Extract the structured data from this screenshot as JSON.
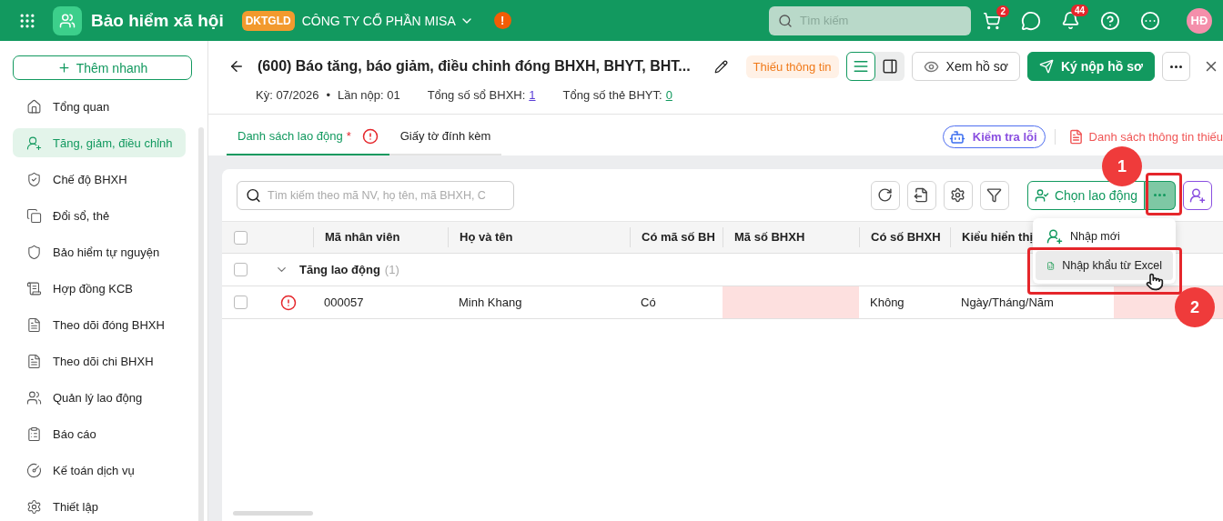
{
  "header": {
    "app_title": "Bảo hiểm xã hội",
    "company_badge": "DKTGLD",
    "company": "CÔNG TY CỔ PHẦN MISA",
    "alert": "!",
    "search_placeholder": "Tìm kiếm",
    "cart_badge": "2",
    "notification_badge": "44",
    "avatar": "HĐ"
  },
  "sidebar": {
    "quick_add": "Thêm nhanh",
    "items": [
      {
        "label": "Tổng quan",
        "selected": false
      },
      {
        "label": "Tăng, giảm, điều chỉnh",
        "selected": true
      },
      {
        "label": "Chế độ BHXH",
        "selected": false
      },
      {
        "label": "Đổi sổ, thẻ",
        "selected": false
      },
      {
        "label": "Bảo hiểm tự nguyện",
        "selected": false
      },
      {
        "label": "Hợp đồng KCB",
        "selected": false
      },
      {
        "label": "Theo dõi đóng BHXH",
        "selected": false
      },
      {
        "label": "Theo dõi chi BHXH",
        "selected": false
      },
      {
        "label": "Quản lý lao động",
        "selected": false
      },
      {
        "label": "Báo cáo",
        "selected": false
      },
      {
        "label": "Kế toán dịch vụ",
        "selected": false
      },
      {
        "label": "Thiết lập",
        "selected": false
      }
    ]
  },
  "document": {
    "title": "(600) Báo tăng, báo giảm, điều chỉnh đóng BHXH, BHYT, BHT...",
    "status": "Thiếu thông tin",
    "period": "Kỳ: 07/2026",
    "separator": "•",
    "submission": "Lần nộp: 01",
    "totals": [
      {
        "label": "Tổng số sổ BHXH:",
        "value": "1"
      },
      {
        "label": "Tổng số thẻ BHYT:",
        "value": "0"
      }
    ],
    "view_modes": [
      {
        "kind": "list",
        "selected": true
      },
      {
        "kind": "split",
        "selected": false
      }
    ],
    "view_button": "Xem hồ sơ",
    "submit_button": "Ký nộp hồ sơ"
  },
  "tabs": [
    {
      "label": "Danh sách lao động",
      "marker": "*",
      "error": true,
      "selected": true
    },
    {
      "label": "Giấy tờ đính kèm",
      "error": false,
      "selected": false
    }
  ],
  "check_errors": "Kiểm tra lỗi",
  "missing_info": "Danh sách thông tin thiếu",
  "toolbar": {
    "search_placeholder": "Tìm kiếm theo mã NV, họ tên, mã BHXH, C",
    "choose_button": "Chọn lao động"
  },
  "menu": [
    {
      "kind": "new",
      "label": "Nhập mới",
      "selected": false
    },
    {
      "kind": "excel",
      "label": "Nhập khẩu từ Excel",
      "selected": true
    }
  ],
  "table": {
    "select_all_checked": false,
    "columns": [
      "Mã nhân viên",
      "Họ và tên",
      "Có mã số BH",
      "Mã số BHXH",
      "Có số BHXH",
      "Kiểu hiển thị"
    ],
    "groups": [
      {
        "label": "Tăng lao động",
        "count": "(1)",
        "expanded": true,
        "checked": false,
        "rows": [
          {
            "checked": false,
            "error": true,
            "cells": [
              {
                "text": "000057",
                "invalid": false
              },
              {
                "text": "Minh Khang",
                "invalid": false
              },
              {
                "text": "Có",
                "invalid": false
              },
              {
                "invalid": true
              },
              {
                "text": "Không",
                "invalid": false
              },
              {
                "text": "Ngày/Tháng/Năm",
                "invalid": false
              },
              {
                "invalid": true
              }
            ]
          }
        ]
      }
    ]
  },
  "callouts": [
    {
      "label": "1"
    },
    {
      "label": "2"
    }
  ]
}
